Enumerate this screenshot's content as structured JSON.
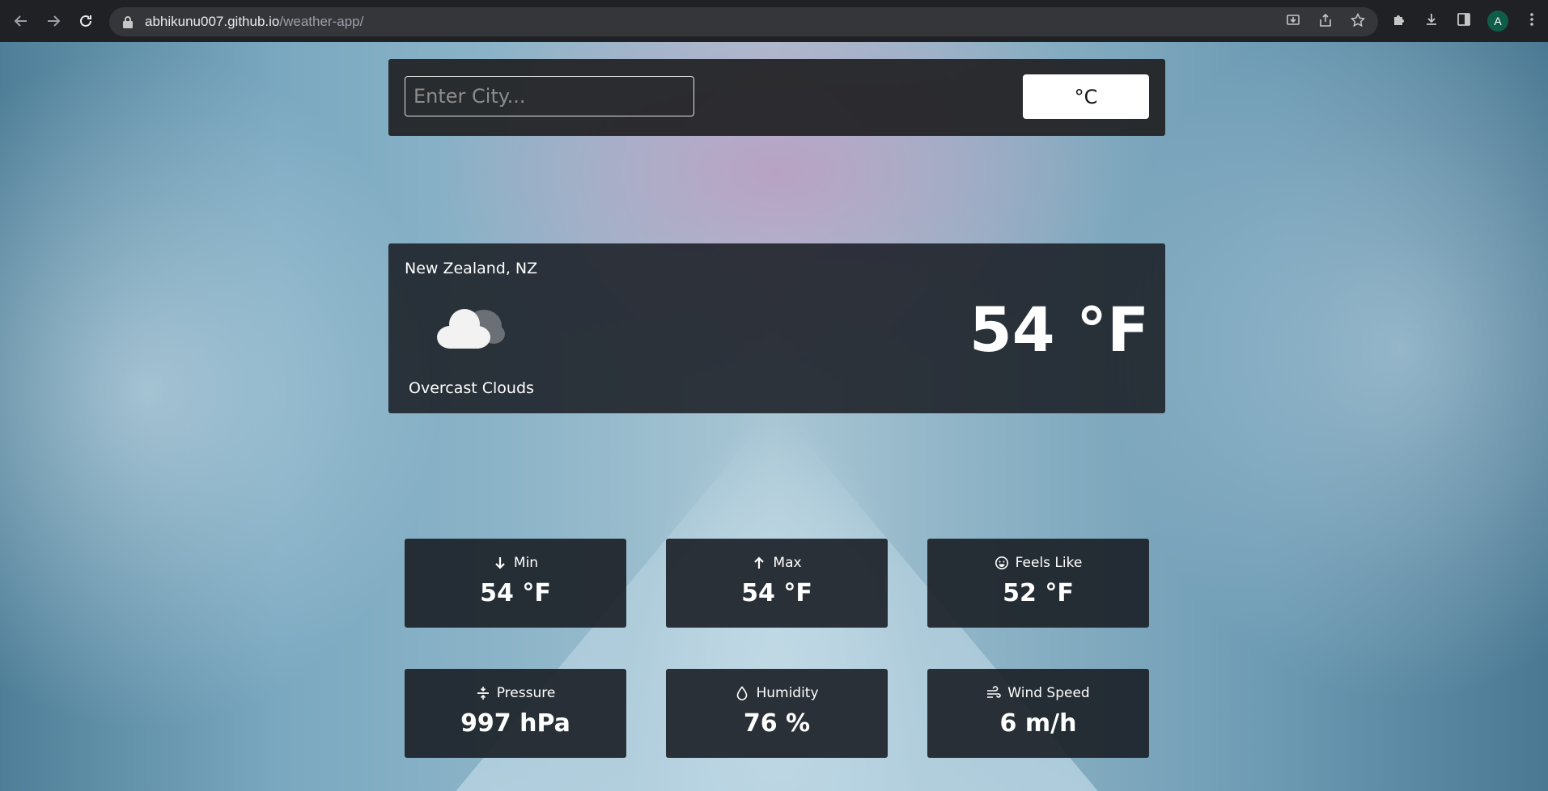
{
  "browser": {
    "url_host": "abhikunu007.github.io",
    "url_path": "/weather-app/",
    "profile_initial": "A"
  },
  "search": {
    "placeholder": "Enter City...",
    "value": "",
    "unit_toggle_label": "°C"
  },
  "current": {
    "location": "New Zealand, NZ",
    "description": "Overcast Clouds",
    "temperature": "54 °F",
    "icon": "overcast-cloud-icon"
  },
  "stats": [
    {
      "label": "Min",
      "value": "54 °F",
      "icon": "arrow-down-icon"
    },
    {
      "label": "Max",
      "value": "54 °F",
      "icon": "arrow-up-icon"
    },
    {
      "label": "Feels Like",
      "value": "52 °F",
      "icon": "smile-icon"
    },
    {
      "label": "Pressure",
      "value": "997 hPa",
      "icon": "compress-icon"
    },
    {
      "label": "Humidity",
      "value": "76 %",
      "icon": "droplet-icon"
    },
    {
      "label": "Wind Speed",
      "value": "6 m/h",
      "icon": "wind-icon"
    }
  ],
  "colors": {
    "panel_bg": "#1b1f26",
    "text": "#ffffff",
    "toggle_bg": "#ffffff"
  }
}
